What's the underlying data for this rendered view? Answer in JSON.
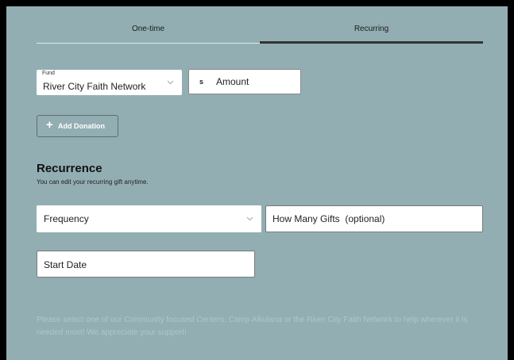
{
  "tabs": [
    {
      "label": "One-time",
      "active": false
    },
    {
      "label": "Recurring",
      "active": true
    }
  ],
  "fund": {
    "label": "Fund",
    "value": "River City Faith Network"
  },
  "amount": {
    "currency": "s",
    "placeholder": "Amount"
  },
  "add_donation": {
    "label": "Add Donation"
  },
  "recurrence": {
    "title": "Recurrence",
    "subtitle": "You can edit your recurring gift anytime.",
    "frequency": {
      "placeholder": "Frequency"
    },
    "gifts": {
      "placeholder": "How Many Gifts  (optional)"
    },
    "start_date": {
      "placeholder": "Start Date"
    }
  },
  "note": "Please select one of our Community focused Centers, Camp Alkulana or the River City Faith Network to help wherever it is needed most! We appreciate your support!",
  "colors": {
    "background": "#92aeb2",
    "active_tab": "#333333",
    "note_text": "#aec6c9"
  }
}
